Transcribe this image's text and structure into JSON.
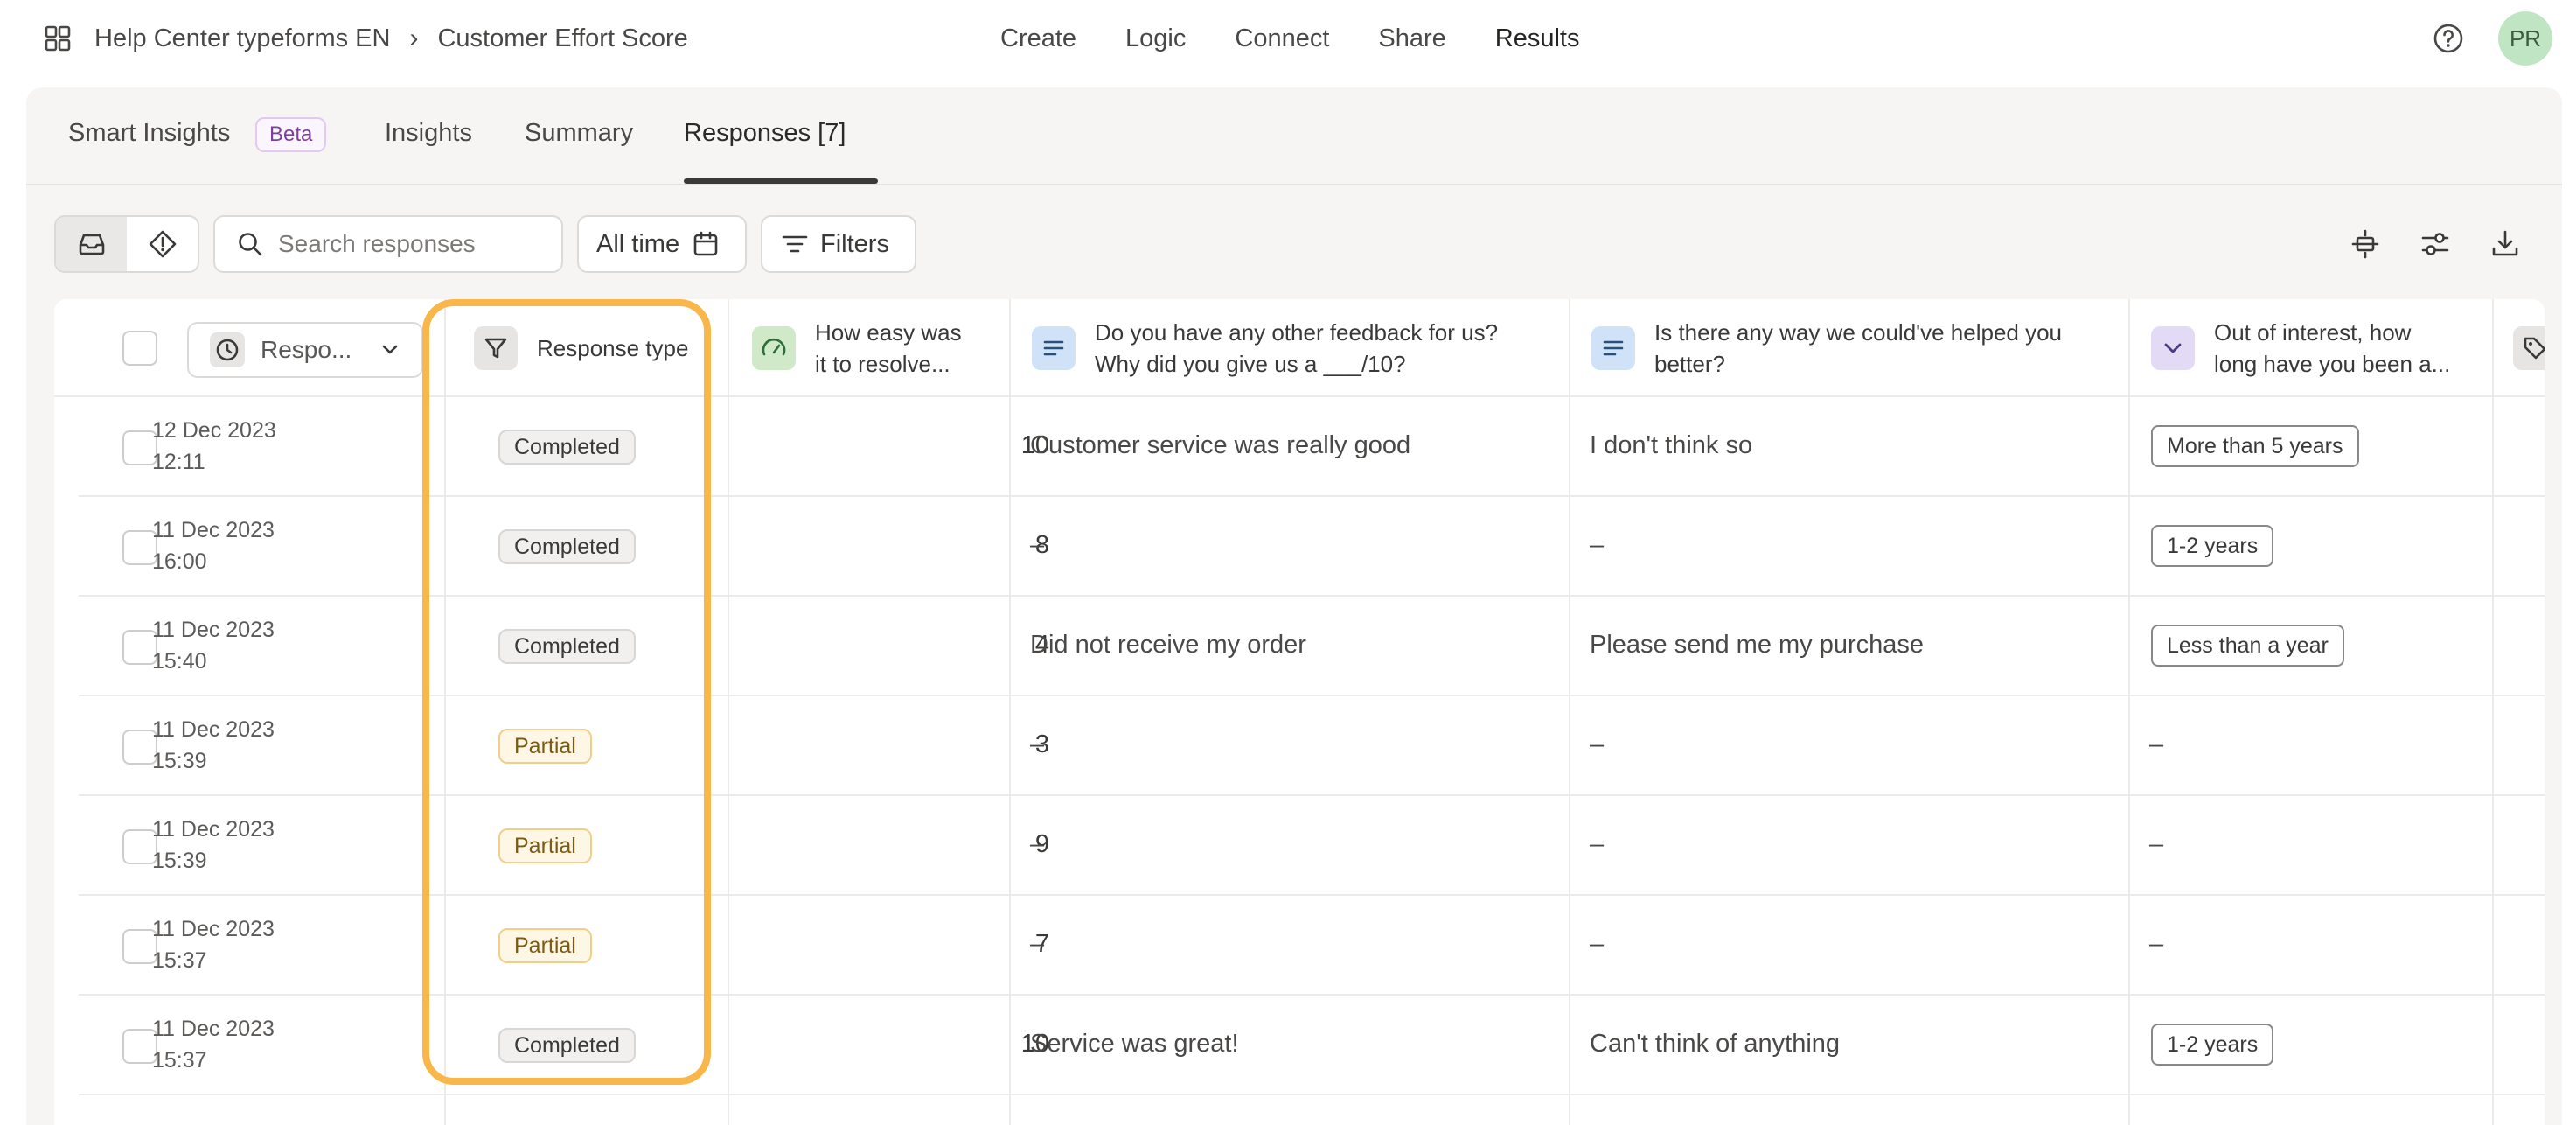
{
  "breadcrumb": {
    "workspace": "Help Center typeforms EN",
    "separator": "›",
    "form": "Customer Effort Score"
  },
  "nav": {
    "create": "Create",
    "logic": "Logic",
    "connect": "Connect",
    "share": "Share",
    "results": "Results"
  },
  "user": {
    "initials": "PR"
  },
  "tabs": {
    "smart_insights": "Smart Insights",
    "beta": "Beta",
    "insights": "Insights",
    "summary": "Summary",
    "responses": "Responses [7]"
  },
  "toolbar": {
    "search_placeholder": "Search responses",
    "date_filter": "All time",
    "filters": "Filters"
  },
  "columns": {
    "submitted": "Respo...",
    "response_type": "Response type",
    "q1": [
      "How easy was",
      "it to resolve..."
    ],
    "q2": [
      "Do you have any other feedback for us?",
      "Why did you give us a ___/10?"
    ],
    "q3": [
      "Is there any way we could've helped you",
      "better?"
    ],
    "q4": [
      "Out of interest, how",
      "long have you been a..."
    ]
  },
  "rows": [
    {
      "date": "12 Dec 2023",
      "time": "12:11",
      "type": "Completed",
      "score": "10",
      "feedback": "Customer service was really good",
      "better": "I don't think so",
      "tenure": "More than 5 years"
    },
    {
      "date": "11 Dec 2023",
      "time": "16:00",
      "type": "Completed",
      "score": "8",
      "feedback": "–",
      "better": "–",
      "tenure": "1-2 years"
    },
    {
      "date": "11 Dec 2023",
      "time": "15:40",
      "type": "Completed",
      "score": "4",
      "feedback": "Did not receive my order",
      "better": "Please send me my purchase",
      "tenure": "Less than a year"
    },
    {
      "date": "11 Dec 2023",
      "time": "15:39",
      "type": "Partial",
      "score": "3",
      "feedback": "–",
      "better": "–",
      "tenure": "–"
    },
    {
      "date": "11 Dec 2023",
      "time": "15:39",
      "type": "Partial",
      "score": "9",
      "feedback": "–",
      "better": "–",
      "tenure": "–"
    },
    {
      "date": "11 Dec 2023",
      "time": "15:37",
      "type": "Partial",
      "score": "7",
      "feedback": "–",
      "better": "–",
      "tenure": "–"
    },
    {
      "date": "11 Dec 2023",
      "time": "15:37",
      "type": "Completed",
      "score": "10",
      "feedback": "Service was great!",
      "better": "Can't think of anything",
      "tenure": "1-2 years"
    }
  ],
  "colors": {
    "highlight": "#f9b74a",
    "partial_bg": "#fff7e6",
    "avatar_bg": "#bfe5c2"
  }
}
